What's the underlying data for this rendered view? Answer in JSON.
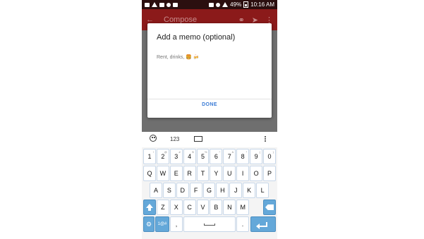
{
  "status_bar": {
    "battery": "49%",
    "time": "10:16 AM"
  },
  "app_bar": {
    "title": "Compose"
  },
  "dialog": {
    "title": "Add a memo (optional)",
    "input_placeholder": "Rent, drinks, 🍔 🍻",
    "done_label": "DONE"
  },
  "keyboard": {
    "toolbar_numeric": "123",
    "number_row": [
      {
        "key": "1",
        "sub": "!"
      },
      {
        "key": "2",
        "sub": "@"
      },
      {
        "key": "3",
        "sub": "#"
      },
      {
        "key": "4",
        "sub": "$"
      },
      {
        "key": "5",
        "sub": "%"
      },
      {
        "key": "6",
        "sub": "^"
      },
      {
        "key": "7",
        "sub": "&"
      },
      {
        "key": "8",
        "sub": "*"
      },
      {
        "key": "9",
        "sub": "("
      },
      {
        "key": "0",
        "sub": ")"
      }
    ],
    "row1": [
      "Q",
      "W",
      "E",
      "R",
      "T",
      "Y",
      "U",
      "I",
      "O",
      "P"
    ],
    "row2": [
      "A",
      "S",
      "D",
      "F",
      "G",
      "H",
      "J",
      "K",
      "L"
    ],
    "row3": [
      "Z",
      "X",
      "C",
      "V",
      "B",
      "N",
      "M"
    ],
    "symbols_label": "1@#",
    "comma": ",",
    "period": "."
  },
  "colors": {
    "app_bar": "#8b1a1a",
    "accent_blue": "#3a7bd5",
    "function_key": "#64a8d9"
  }
}
